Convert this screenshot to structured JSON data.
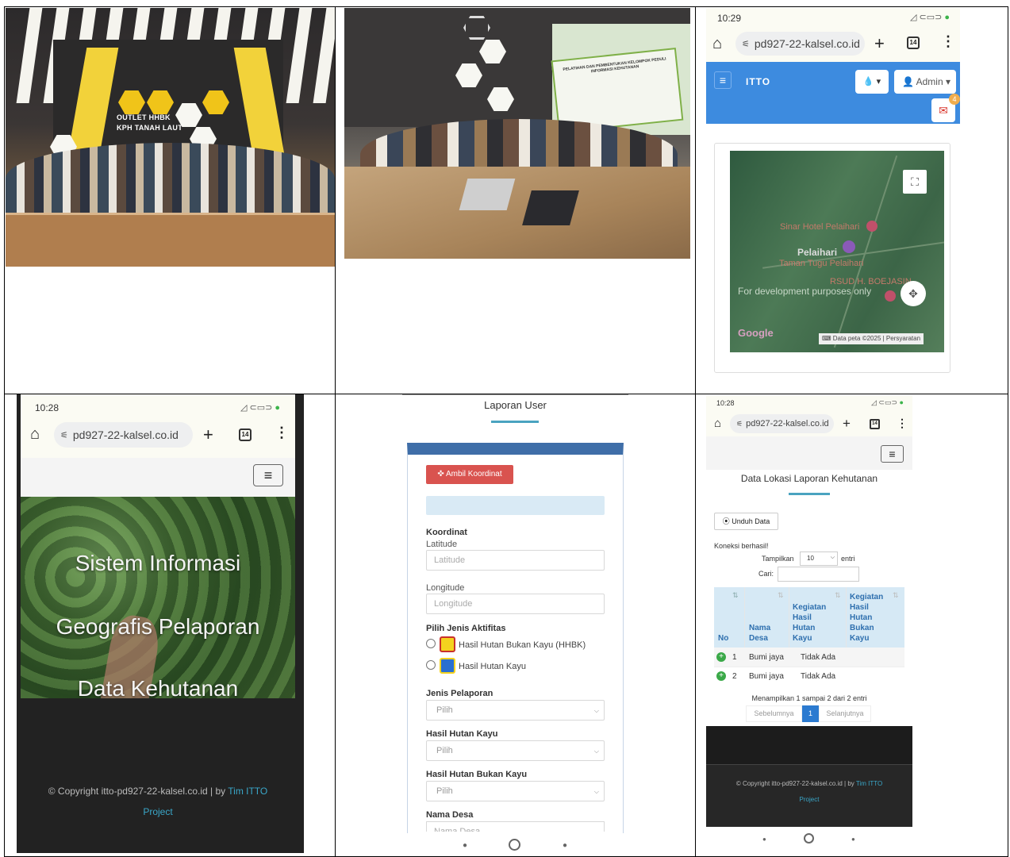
{
  "cell1": {
    "sign_line1": "OUTLET HHBK",
    "sign_line2": "KPH TANAH LAUT"
  },
  "cell2": {
    "banner_text": "PELATIHAN DAN PEMBENTUKAN KELOMPOK PEDULI INFORMASI KEHUTANAN"
  },
  "cell3": {
    "time": "10:29",
    "url": "pd927-22-kalsel.co.id",
    "tab_count": "14",
    "brand": "ITTO",
    "admin_label": "Admin",
    "mail_badge": "4",
    "map": {
      "place1": "Sinar Hotel Pelaihari",
      "place2": "Pelaihari",
      "place3": "Taman Tugu Pelaihari",
      "place4": "RSUD H. BOEJASIN",
      "dev_notice": "For development purposes only",
      "logo": "Google",
      "attribution": "Data peta ©2025",
      "terms": "Persyaratan"
    }
  },
  "cell4": {
    "time": "10:28",
    "url": "pd927-22-kalsel.co.id",
    "tab_count": "14",
    "hero_line1": "Sistem Informasi",
    "hero_line2": "Geografis Pelaporan",
    "hero_line3": "Data Kehutanan",
    "copyright": "© Copyright itto-pd927-22-kalsel.co.id | by",
    "team": "Tim ITTO",
    "project": "Project"
  },
  "cell5": {
    "title": "Laporan User",
    "ambil_btn": "Ambil Koordinat",
    "koordinat_label": "Koordinat",
    "latitude_label": "Latitude",
    "latitude_placeholder": "Latitude",
    "longitude_label": "Longitude",
    "longitude_placeholder": "Longitude",
    "aktifitas_label": "Pilih Jenis Aktifitas",
    "option1": "Hasil Hutan Bukan Kayu (HHBK)",
    "option2": "Hasil Hutan Kayu",
    "jenis_label": "Jenis Pelaporan",
    "select_placeholder": "Pilih",
    "hhk_label": "Hasil Hutan Kayu",
    "hhbk_label": "Hasil Hutan Bukan Kayu",
    "desa_label": "Nama Desa",
    "desa_placeholder": "Nama Desa"
  },
  "cell6": {
    "time": "10:28",
    "url": "pd927-22-kalsel.co.id",
    "tab_count": "14",
    "title": "Data Lokasi Laporan Kehutanan",
    "unduh_btn": "Unduh Data",
    "koneksi": "Koneksi berhasil!",
    "tampilkan": "Tampilkan",
    "entries_value": "10",
    "entri": "entri",
    "cari": "Cari:",
    "headers": {
      "no": "No",
      "desa_l1": "Nama",
      "desa_l2": "Desa",
      "hk_l1": "Kegiatan",
      "hk_l2": "Hasil",
      "hk_l3": "Hutan",
      "hk_l4": "Kayu",
      "hbk_l1": "Kegiatan",
      "hbk_l2": "Hasil",
      "hbk_l3": "Hutan",
      "hbk_l4": "Bukan",
      "hbk_l5": "Kayu"
    },
    "rows": [
      {
        "no": "1",
        "desa": "Bumi jaya",
        "hk": "Tidak Ada",
        "hbk": ""
      },
      {
        "no": "2",
        "desa": "Bumi jaya",
        "hk": "Tidak Ada",
        "hbk": ""
      }
    ],
    "info": "Menampilkan 1 sampai 2 dari 2 entri",
    "prev": "Sebelumnya",
    "page": "1",
    "next": "Selanjutnya",
    "copyright": "© Copyright itto-pd927-22-kalsel.co.id | by",
    "team": "Tim ITTO",
    "project": "Project"
  }
}
